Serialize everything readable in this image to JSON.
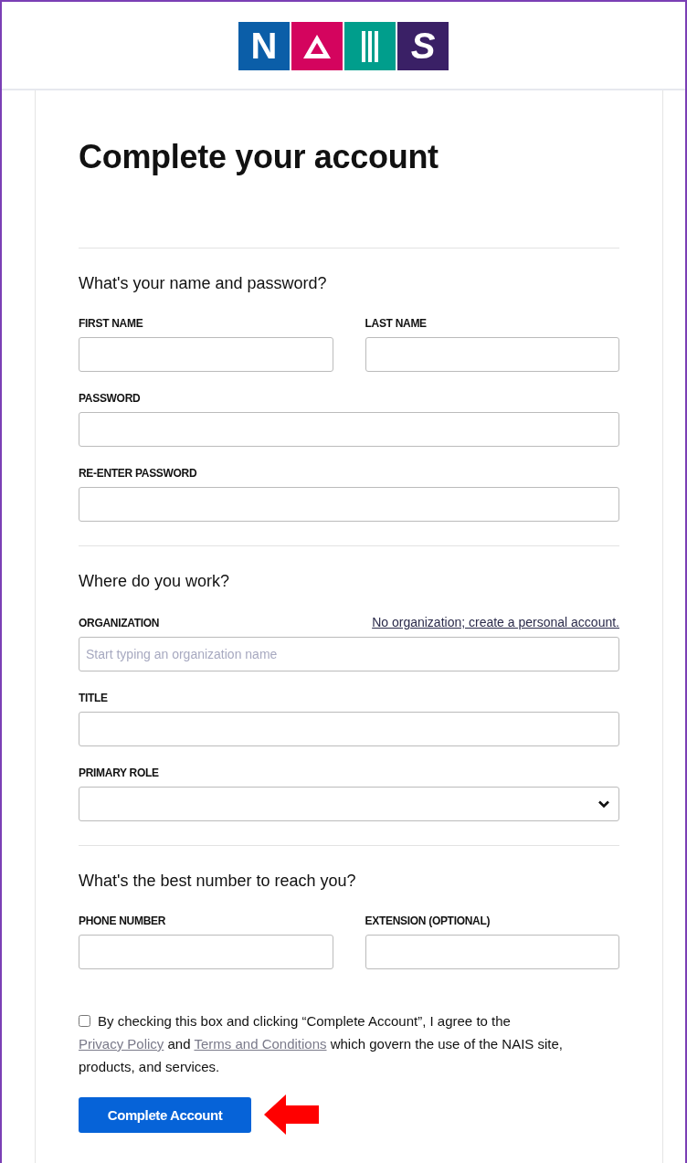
{
  "logo": [
    {
      "kind": "letter",
      "text": "N",
      "color": "#0b5ea8"
    },
    {
      "kind": "triangle",
      "color": "#d4045e"
    },
    {
      "kind": "bars",
      "color": "#009e8c"
    },
    {
      "kind": "letter",
      "text": "S",
      "color": "#3a2066"
    }
  ],
  "title": "Complete your account",
  "sections": [
    {
      "heading": "What's your name and password?",
      "rows": [
        [
          {
            "label": "FIRST NAME",
            "kind": "text"
          },
          {
            "label": "LAST NAME",
            "kind": "text"
          }
        ],
        [
          {
            "label": "PASSWORD",
            "kind": "text"
          }
        ],
        [
          {
            "label": "RE-ENTER PASSWORD",
            "kind": "text"
          }
        ]
      ]
    },
    {
      "heading": "Where do you work?",
      "rows": [
        [
          {
            "label": "ORGANIZATION",
            "kind": "text",
            "link": "No organization; create a personal account.",
            "placeholder": "Start typing an organization name"
          }
        ],
        [
          {
            "label": "TITLE",
            "kind": "text"
          }
        ],
        [
          {
            "label": "PRIMARY ROLE",
            "kind": "select"
          }
        ]
      ]
    },
    {
      "heading": "What's the best number to reach you?",
      "rows": [
        [
          {
            "label": "PHONE NUMBER",
            "kind": "text"
          },
          {
            "label": "EXTENSION (OPTIONAL)",
            "kind": "text"
          }
        ]
      ]
    }
  ],
  "consent": {
    "checked": false,
    "parts": [
      {
        "kind": "text",
        "text": "By checking this box and clicking “Complete Account”, I agree to the "
      },
      {
        "kind": "link",
        "text": "Privacy Policy"
      },
      {
        "kind": "text",
        "text": " and "
      },
      {
        "kind": "link",
        "text": "Terms and Conditions"
      },
      {
        "kind": "text",
        "text": " which govern the use of the NAIS site, products, and services."
      }
    ]
  },
  "submit": {
    "label": "Complete Account"
  },
  "annotation": {
    "kind": "arrow"
  }
}
